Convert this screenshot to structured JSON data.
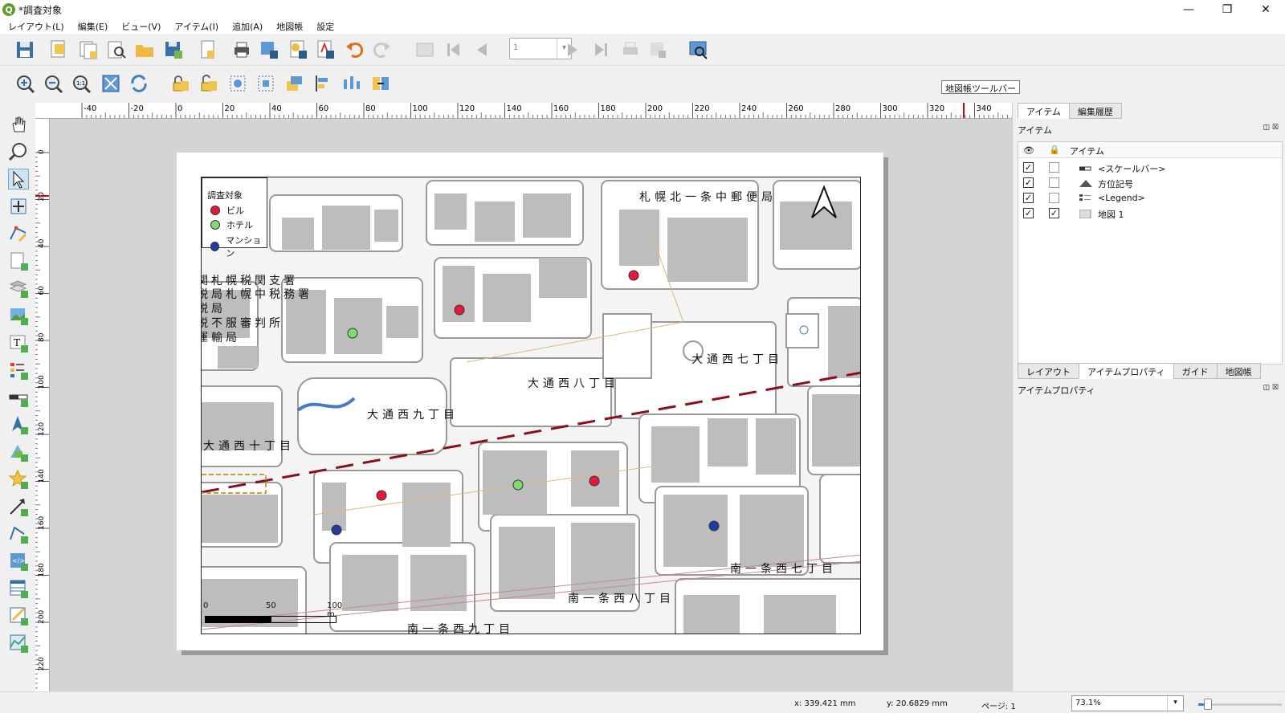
{
  "window": {
    "title": "*調査対象",
    "logo": "Q",
    "minimize": "—",
    "restore": "❐",
    "close": "✕"
  },
  "menu": [
    "レイアウト(L)",
    "編集(E)",
    "ビュー(V)",
    "アイテム(I)",
    "追加(A)",
    "地図帳",
    "設定"
  ],
  "toolbar": {
    "page_number": "1",
    "tooltip": "地図帳ツールバー"
  },
  "ruler": {
    "h_ticks": [
      "-40",
      "-20",
      "0",
      "20",
      "40",
      "60",
      "80",
      "100",
      "120",
      "140",
      "160",
      "180",
      "200",
      "220",
      "240",
      "260",
      "280",
      "300",
      "320",
      "340"
    ],
    "v_ticks": [
      "0",
      "20",
      "40",
      "60",
      "80",
      "100",
      "120",
      "140",
      "160",
      "180",
      "200",
      "220"
    ]
  },
  "map": {
    "labels": [
      {
        "text": "札幌北一条中郵便局"
      },
      {
        "text": "関札幌税関支署"
      },
      {
        "text": "税局札幌中税務署"
      },
      {
        "text": "税局"
      },
      {
        "text": "税不服審判所"
      },
      {
        "text": "運輸局"
      },
      {
        "text": "大通西七丁目"
      },
      {
        "text": "大通西八丁目"
      },
      {
        "text": "大通西九丁目"
      },
      {
        "text": "大通西十丁目"
      },
      {
        "text": "南一条西七丁目"
      },
      {
        "text": "南一条西八丁目"
      },
      {
        "text": "南一条西九丁目"
      }
    ],
    "legend": {
      "title": "調査対象",
      "items": [
        {
          "label": "ビル",
          "color": "#e8173c"
        },
        {
          "label": "ホテル",
          "color": "#7fdc6e"
        },
        {
          "label": "マンション",
          "color": "#1f3ea0"
        }
      ]
    },
    "scalebar": {
      "labels": [
        "0",
        "50",
        "100 m"
      ]
    },
    "north_arrow": "north-arrow"
  },
  "right_panel": {
    "top_tabs": [
      "アイテム",
      "編集履歴"
    ],
    "items_header": "アイテム",
    "column_header": "アイテム",
    "items": [
      {
        "label": "<スケールバー>",
        "visible": "✓",
        "locked": "",
        "icon": "scalebar-icon"
      },
      {
        "label": "方位記号",
        "visible": "✓",
        "locked": "",
        "icon": "north-arrow-icon"
      },
      {
        "label": "<Legend>",
        "visible": "✓",
        "locked": "",
        "icon": "legend-icon"
      },
      {
        "label": "地図 1",
        "visible": "✓",
        "locked": "✓",
        "icon": "map-icon"
      }
    ],
    "bottom_tabs": [
      "レイアウト",
      "アイテムプロパティ",
      "ガイド",
      "地図帳"
    ],
    "properties_header": "アイテムプロパティ"
  },
  "status": {
    "x": "x: 339.421 mm",
    "y": "y: 20.6829 mm",
    "page": "ページ: 1",
    "zoom": "73.1%",
    "zoom_fraction": 0.12
  }
}
